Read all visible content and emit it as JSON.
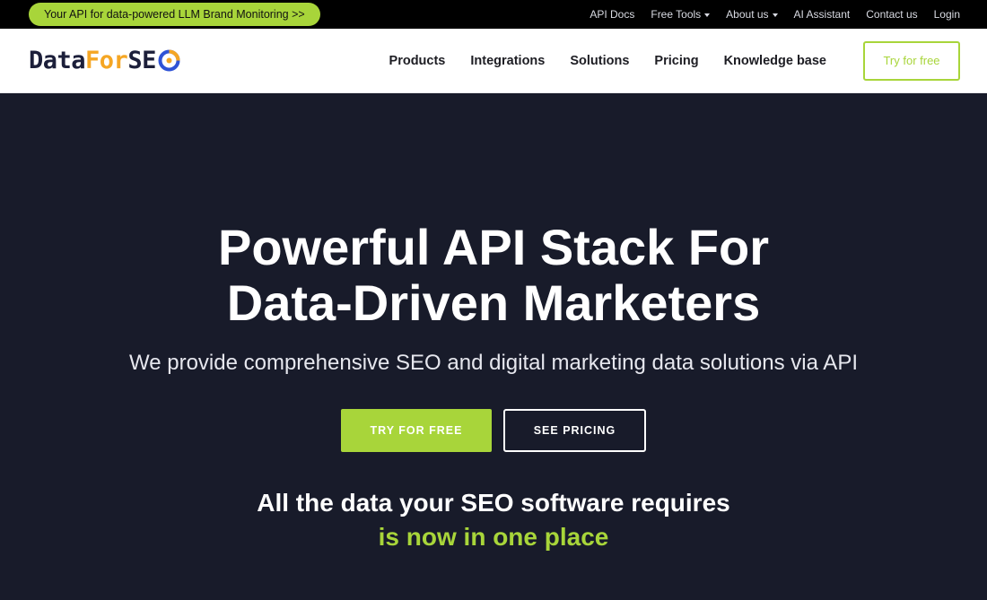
{
  "topbar": {
    "promo": "Your API for data-powered LLM Brand Monitoring >>",
    "links": {
      "api_docs": "API Docs",
      "free_tools": "Free Tools",
      "about_us": "About us",
      "ai_assistant": "AI Assistant",
      "contact_us": "Contact us",
      "login": "Login"
    }
  },
  "navbar": {
    "logo": {
      "part1": "Data",
      "part2": "For",
      "part3": "SE"
    },
    "items": {
      "products": "Products",
      "integrations": "Integrations",
      "solutions": "Solutions",
      "pricing": "Pricing",
      "knowledge_base": "Knowledge base"
    },
    "try_label": "Try for free"
  },
  "hero": {
    "title_line1": "Powerful API Stack For",
    "title_line2": "Data-Driven Marketers",
    "subtitle": "We provide comprehensive SEO and digital marketing data solutions via API",
    "cta_primary": "TRY FOR FREE",
    "cta_secondary": "SEE PRICING",
    "tagline_line1": "All the data your SEO software requires",
    "tagline_line2": "is now in one place"
  },
  "colors": {
    "accent_green": "#a8d53a",
    "hero_bg": "#181b2a",
    "logo_dark": "#1c1f3a",
    "logo_orange": "#f5a623",
    "logo_blue": "#2f53d6"
  }
}
